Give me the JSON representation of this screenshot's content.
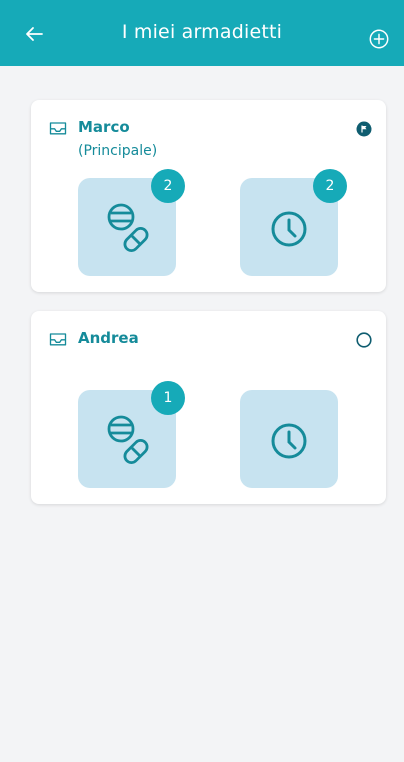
{
  "header": {
    "title": "I miei armadietti"
  },
  "cabinets": [
    {
      "name": "Marco",
      "subtitle": "(Principale)",
      "is_main": true,
      "medicines_count": "2",
      "reminders_count": "2"
    },
    {
      "name": "Andrea",
      "subtitle": "",
      "is_main": false,
      "medicines_count": "1",
      "reminders_count": ""
    }
  ],
  "colors": {
    "primary": "#16aab8",
    "text": "#158b9a",
    "tile": "#c7e3f0"
  },
  "icons": {
    "back": "arrow-left-icon",
    "add": "plus-circle-icon",
    "cabinet": "inbox-icon",
    "main": "flag-circle-icon",
    "not_main": "empty-circle-icon",
    "medicine": "pills-icon",
    "reminder": "clock-icon"
  }
}
